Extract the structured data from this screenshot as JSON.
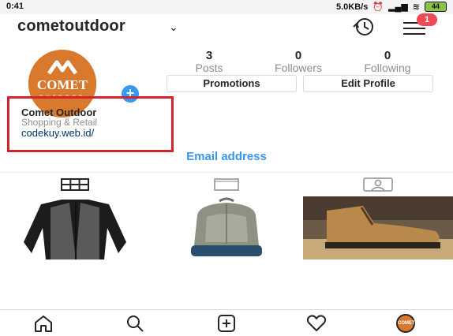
{
  "status": {
    "time": "0:41",
    "network_speed": "5.0KB/s",
    "battery": "44"
  },
  "header": {
    "username": "cometoutdoor",
    "notification_count": "1"
  },
  "avatar": {
    "logo_text": "COMET",
    "logo_subtext": "OUTDOOR"
  },
  "stats": {
    "posts_count": "3",
    "posts_label": "Posts",
    "followers_count": "0",
    "followers_label": "Followers",
    "following_count": "0",
    "following_label": "Following"
  },
  "buttons": {
    "promotions": "Promotions",
    "edit_profile": "Edit Profile"
  },
  "bio": {
    "name": "Comet Outdoor",
    "category": "Shopping & Retail",
    "website": "codekuy.web.id/"
  },
  "contact": {
    "email_label": "Email address"
  },
  "tabs": [
    "grid",
    "feed",
    "tagged"
  ],
  "posts": [
    "jacket",
    "backpack",
    "boot"
  ],
  "bottom_nav": [
    "home",
    "search",
    "add",
    "activity",
    "profile"
  ],
  "colors": {
    "brand_orange": "#d8792e",
    "link_blue": "#3897f0",
    "highlight_red": "#d3232b",
    "badge_red": "#ed4956"
  }
}
